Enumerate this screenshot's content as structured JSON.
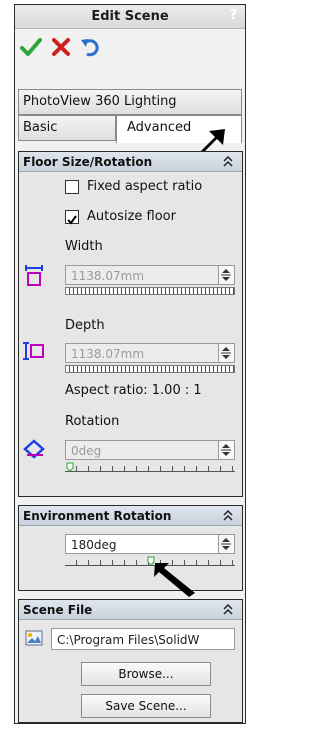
{
  "header": {
    "title": "Edit Scene",
    "help": "?"
  },
  "actions": {
    "ok": "ok",
    "cancel": "cancel",
    "undo": "undo"
  },
  "tabs": {
    "top": "PhotoView 360 Lighting",
    "basic": "Basic",
    "advanced": "Advanced"
  },
  "floor": {
    "title": "Floor Size/Rotation",
    "fixed_aspect": "Fixed aspect ratio",
    "autosize": "Autosize floor",
    "width_label": "Width",
    "width_value": "1138.07mm",
    "depth_label": "Depth",
    "depth_value": "1138.07mm",
    "aspect": "Aspect ratio: 1.00 : 1",
    "rotation_label": "Rotation",
    "rotation_value": "0deg",
    "fixed_aspect_checked": false,
    "autosize_checked": true
  },
  "environment": {
    "title": "Environment Rotation",
    "value": "180deg"
  },
  "scene_file": {
    "title": "Scene File",
    "path": "C:\\Program Files\\SolidW",
    "browse": "Browse...",
    "save": "Save Scene..."
  },
  "colors": {
    "accent_blue": "#1f3fe0",
    "magenta": "#c000c0",
    "ok_green": "#2aa63a",
    "cancel_red": "#d01f1f"
  }
}
